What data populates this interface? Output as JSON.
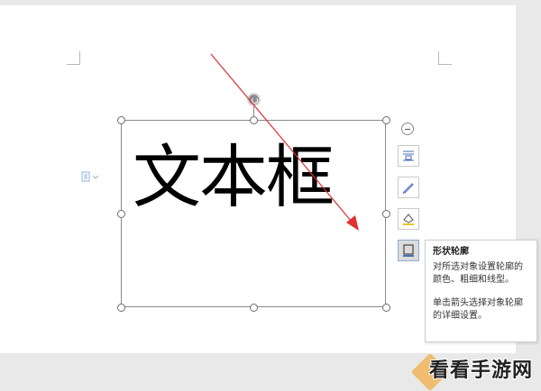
{
  "document": {
    "textbox_text": "文本框"
  },
  "tooltip": {
    "title": "形状轮廓",
    "line1": "对所选对象设置轮廓的颜色、粗细和线型。",
    "line2": "单击箭头选择对象轮廓的详细设置。"
  },
  "watermark": {
    "text": "看看手游网"
  },
  "icons": {
    "anchor": "layout-anchor-icon",
    "collapse": "collapse-icon",
    "wrap": "text-wrap-icon",
    "fill": "shape-fill-pen-icon",
    "effect": "shape-effect-icon",
    "outline": "shape-outline-icon"
  },
  "colors": {
    "arrow": "#e03030",
    "selection_border": "#8a8a8a",
    "accent": "#8fa9d6"
  }
}
